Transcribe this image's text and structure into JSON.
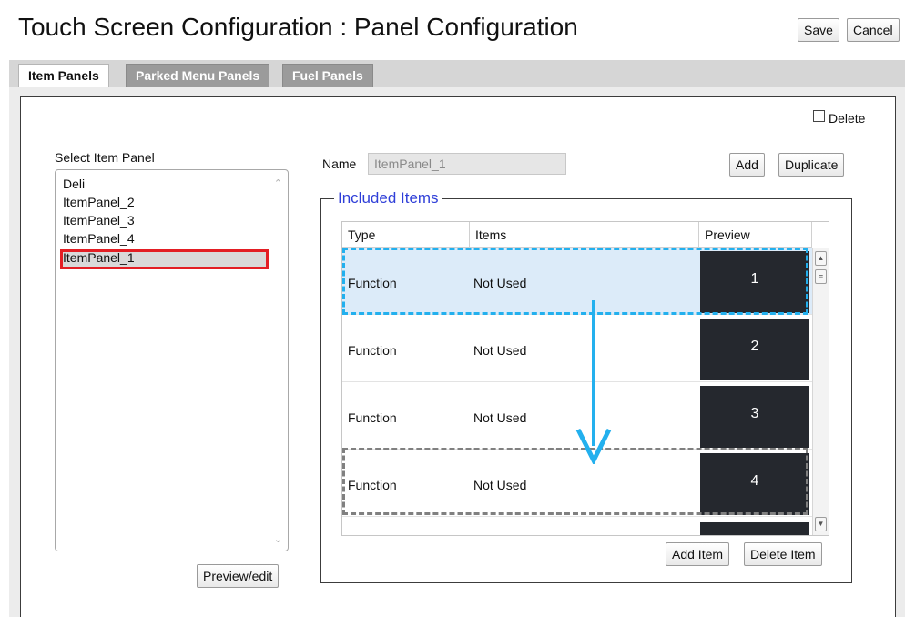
{
  "header": {
    "title": "Touch Screen Configuration : Panel Configuration",
    "save_label": "Save",
    "cancel_label": "Cancel"
  },
  "tabs": [
    {
      "label": "Item Panels",
      "active": true
    },
    {
      "label": "Parked Menu Panels",
      "active": false
    },
    {
      "label": "Fuel Panels",
      "active": false
    }
  ],
  "delete_label": "Delete",
  "delete_checked": false,
  "item_panel_list": {
    "label": "Select Item Panel",
    "items": [
      "Deli",
      "ItemPanel_2",
      "ItemPanel_3",
      "ItemPanel_4",
      "ItemPanel_1"
    ],
    "selected": "ItemPanel_1"
  },
  "preview_edit_label": "Preview/edit",
  "name": {
    "label": "Name",
    "value": "ItemPanel_1"
  },
  "add_label": "Add",
  "duplicate_label": "Duplicate",
  "included_items": {
    "legend": "Included Items",
    "columns": [
      "Type",
      "Items",
      "Preview"
    ],
    "rows": [
      {
        "type": "Function",
        "item": "Not Used",
        "preview": "1",
        "selected": true
      },
      {
        "type": "Function",
        "item": "Not Used",
        "preview": "2",
        "selected": false
      },
      {
        "type": "Function",
        "item": "Not Used",
        "preview": "3",
        "selected": false
      },
      {
        "type": "Function",
        "item": "Not Used",
        "preview": "4",
        "selected": false
      }
    ]
  },
  "add_item_label": "Add Item",
  "delete_item_label": "Delete Item",
  "colors": {
    "selected_row": "#dcebf9",
    "preview_tile": "#25282e",
    "drag_source_outline": "#23b0ee",
    "drop_target_outline": "#808080",
    "selection_highlight": "#e31e24",
    "legend_text": "#2f3fd8"
  }
}
